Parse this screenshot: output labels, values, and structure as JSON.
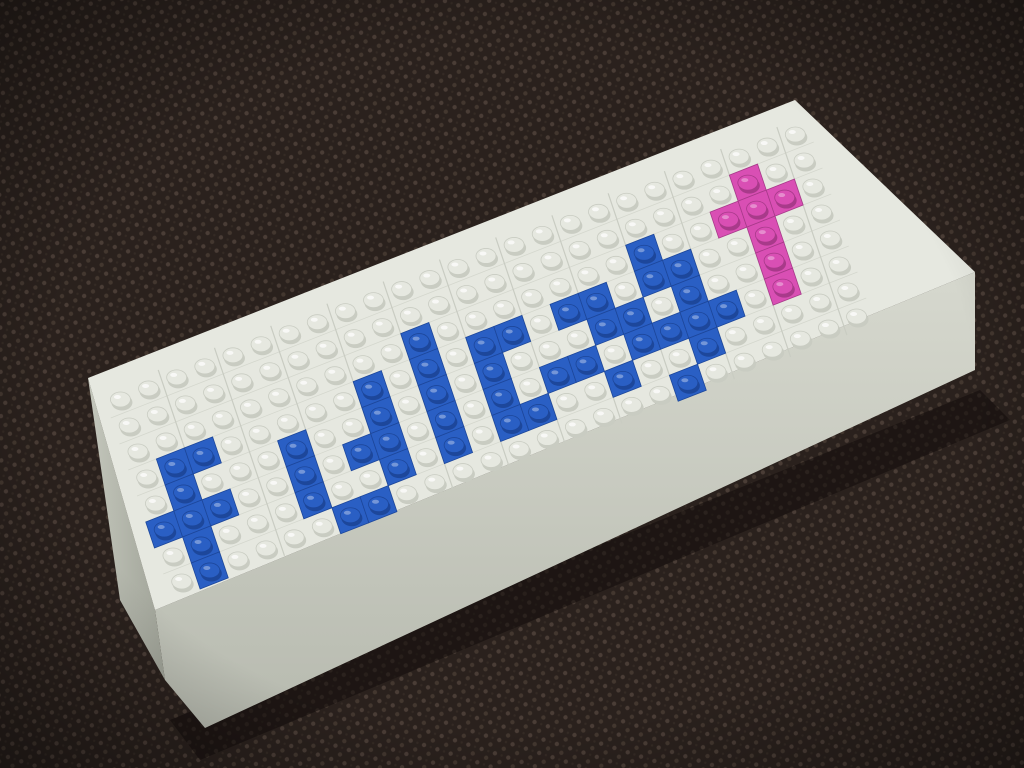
{
  "scene": {
    "subject": "lego-block-sign",
    "letter_shapes": "ディ吉ト"
  },
  "colors": {
    "carpet_dark": "#2a211d",
    "carpet_light": "#4a3d36",
    "brick_white": "#e6e8e0",
    "brick_white_shadow": "#c9ccc2",
    "brick_side": "#cfd1c7",
    "brick_side_shadow": "#a9aca2",
    "brick_blue": "#2a5fc4",
    "brick_blue_shadow": "#1d479b",
    "brick_pink": "#d94fb4",
    "brick_pink_shadow": "#a83a8a"
  }
}
